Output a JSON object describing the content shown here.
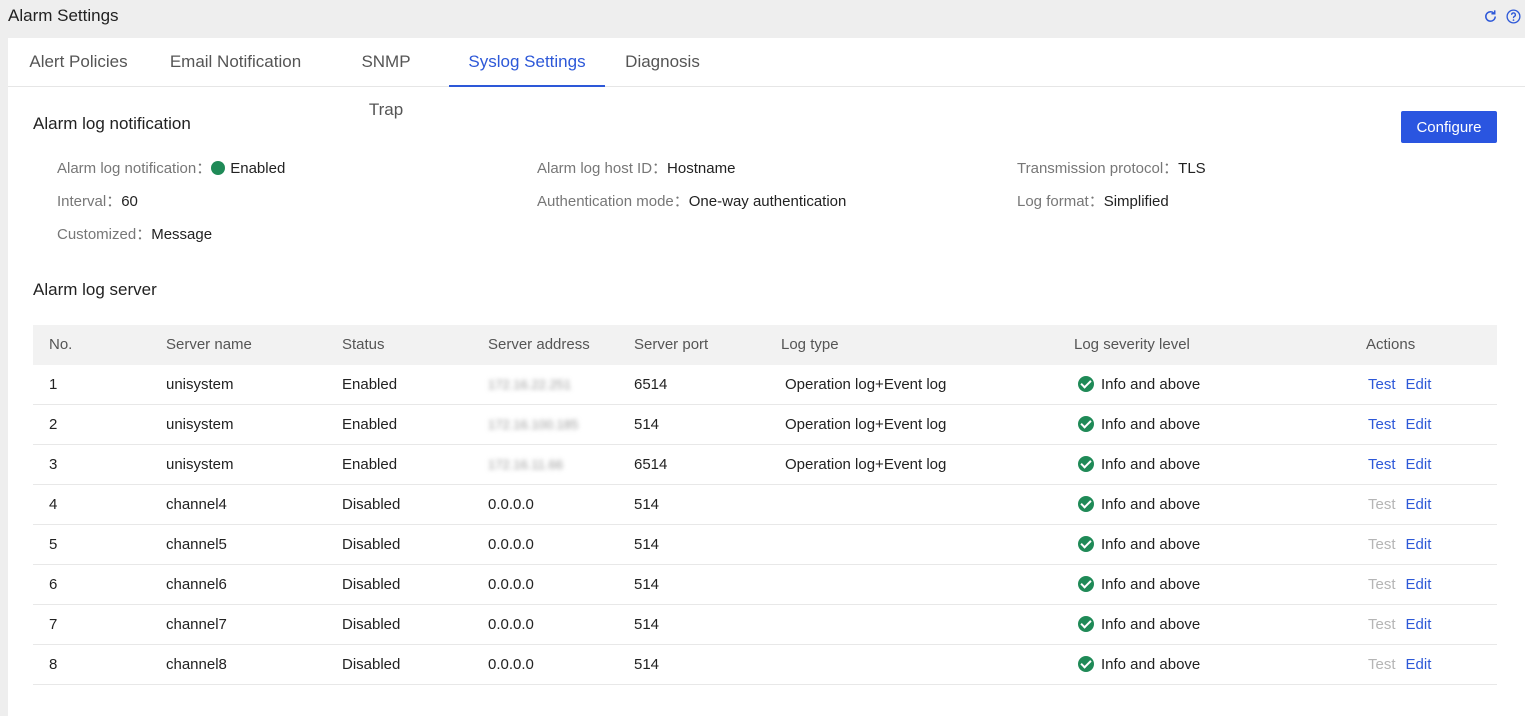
{
  "header": {
    "title": "Alarm Settings",
    "icons": [
      "refresh-icon",
      "help-icon"
    ]
  },
  "tabs": [
    {
      "label": "Alert Policies",
      "active": false
    },
    {
      "label": "Email Notification",
      "active": false
    },
    {
      "label": "SNMP Trap",
      "active": false
    },
    {
      "label": "Syslog Settings",
      "active": true
    },
    {
      "label": "Diagnosis",
      "active": false
    }
  ],
  "notification": {
    "title": "Alarm log notification",
    "configure_label": "Configure",
    "fields": {
      "enabled": {
        "label": "Alarm log notification：",
        "value": "Enabled"
      },
      "host_id": {
        "label": "Alarm log host ID：",
        "value": "Hostname"
      },
      "protocol": {
        "label": "Transmission protocol：",
        "value": "TLS"
      },
      "interval": {
        "label": "Interval：",
        "value": "60"
      },
      "auth_mode": {
        "label": "Authentication mode：",
        "value": "One-way authentication"
      },
      "log_format": {
        "label": "Log format：",
        "value": "Simplified"
      },
      "customized": {
        "label": "Customized：",
        "value": "Message"
      }
    }
  },
  "servers": {
    "title": "Alarm log server",
    "columns": [
      "No.",
      "Server name",
      "Status",
      "Server address",
      "Server port",
      "Log type",
      "Log severity level",
      "Actions"
    ],
    "test_label": "Test",
    "edit_label": "Edit",
    "rows": [
      {
        "no": "1",
        "name": "unisystem",
        "status": "Enabled",
        "address": "172.16.22.251",
        "address_blurred": true,
        "port": "6514",
        "log_type": "Operation log+Event log",
        "severity": "Info and above",
        "test_enabled": true
      },
      {
        "no": "2",
        "name": "unisystem",
        "status": "Enabled",
        "address": "172.16.100.185",
        "address_blurred": true,
        "port": "514",
        "log_type": "Operation log+Event log",
        "severity": "Info and above",
        "test_enabled": true
      },
      {
        "no": "3",
        "name": "unisystem",
        "status": "Enabled",
        "address": "172.16.11.66",
        "address_blurred": true,
        "port": "6514",
        "log_type": "Operation log+Event log",
        "severity": "Info and above",
        "test_enabled": true
      },
      {
        "no": "4",
        "name": "channel4",
        "status": "Disabled",
        "address": "0.0.0.0",
        "address_blurred": false,
        "port": "514",
        "log_type": "",
        "severity": "Info and above",
        "test_enabled": false
      },
      {
        "no": "5",
        "name": "channel5",
        "status": "Disabled",
        "address": "0.0.0.0",
        "address_blurred": false,
        "port": "514",
        "log_type": "",
        "severity": "Info and above",
        "test_enabled": false
      },
      {
        "no": "6",
        "name": "channel6",
        "status": "Disabled",
        "address": "0.0.0.0",
        "address_blurred": false,
        "port": "514",
        "log_type": "",
        "severity": "Info and above",
        "test_enabled": false
      },
      {
        "no": "7",
        "name": "channel7",
        "status": "Disabled",
        "address": "0.0.0.0",
        "address_blurred": false,
        "port": "514",
        "log_type": "",
        "severity": "Info and above",
        "test_enabled": false
      },
      {
        "no": "8",
        "name": "channel8",
        "status": "Disabled",
        "address": "0.0.0.0",
        "address_blurred": false,
        "port": "514",
        "log_type": "",
        "severity": "Info and above",
        "test_enabled": false
      }
    ]
  },
  "colors": {
    "accent": "#2d58d8",
    "button": "#2a55e0",
    "success": "#1f8a57",
    "disabled_link": "#b5b5b5"
  }
}
